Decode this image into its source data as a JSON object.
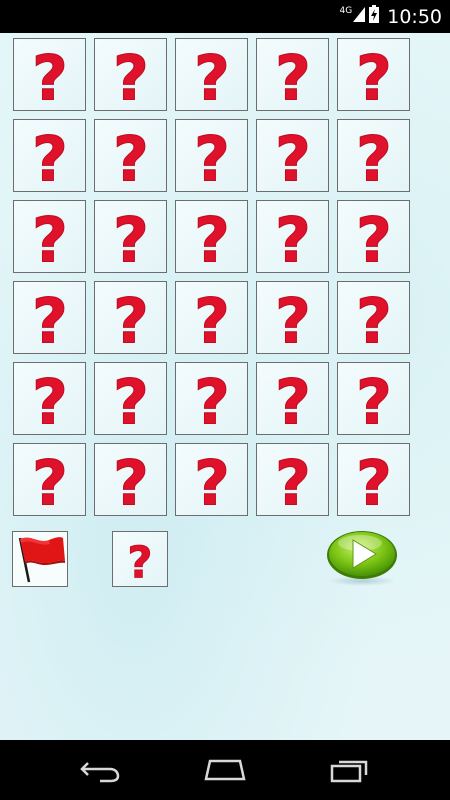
{
  "status_bar": {
    "network": "4G",
    "time": "10:50",
    "icons": [
      "signal-icon",
      "battery-charging-icon"
    ]
  },
  "board": {
    "rows": 6,
    "cols": 5,
    "card_symbol": "?",
    "card_color": "#e0112b",
    "cards_face_down": 30
  },
  "controls": {
    "flag_icon": "red-flag-icon",
    "hint_symbol": "?",
    "play_icon": "play-icon",
    "play_color": "#7cc414"
  },
  "nav_bar": {
    "buttons": [
      "back-icon",
      "home-icon",
      "recent-apps-icon"
    ]
  }
}
